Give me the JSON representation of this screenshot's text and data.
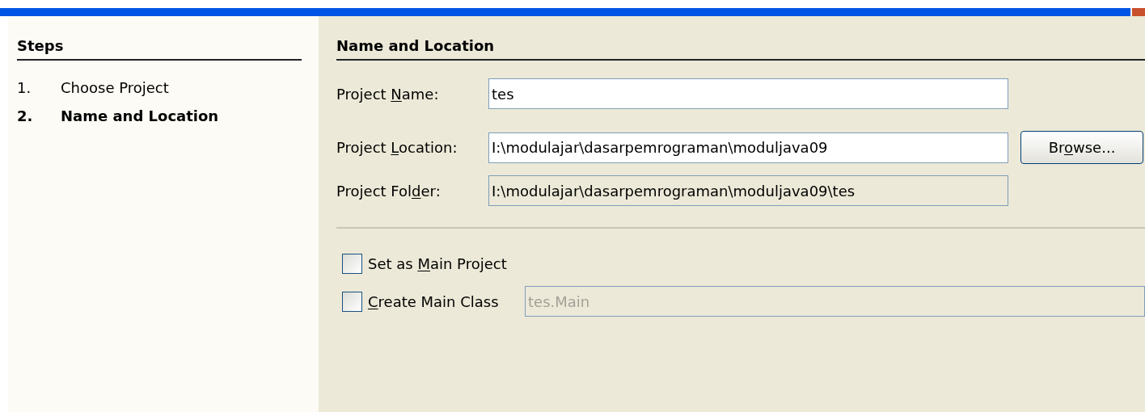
{
  "steps": {
    "title": "Steps",
    "items": [
      {
        "number": "1.",
        "label": "Choose Project",
        "selected": false
      },
      {
        "number": "2.",
        "label": "Name and Location",
        "selected": true
      }
    ]
  },
  "panel": {
    "title": "Name and Location",
    "fields": [
      {
        "label": {
          "before": "Project ",
          "key": "N",
          "after": "ame:"
        },
        "value": "tes",
        "readonly": false
      },
      {
        "label": {
          "before": "Project ",
          "key": "L",
          "after": "ocation:"
        },
        "value": "I:\\modulajar\\dasarpemrograman\\moduljava09",
        "readonly": false,
        "button": {
          "before": "Br",
          "key": "o",
          "after": "wse..."
        }
      },
      {
        "label": {
          "before": "Project Fol",
          "key": "d",
          "after": "er:"
        },
        "value": "I:\\modulajar\\dasarpemrograman\\moduljava09\\tes",
        "readonly": true
      }
    ],
    "options": [
      {
        "label": {
          "before": "Set as ",
          "key": "M",
          "after": "ain Project"
        },
        "checked": false
      },
      {
        "label": {
          "key": "C",
          "after": "reate Main Class"
        },
        "checked": false,
        "field": {
          "value": "tes.Main",
          "disabled": true
        }
      }
    ]
  }
}
